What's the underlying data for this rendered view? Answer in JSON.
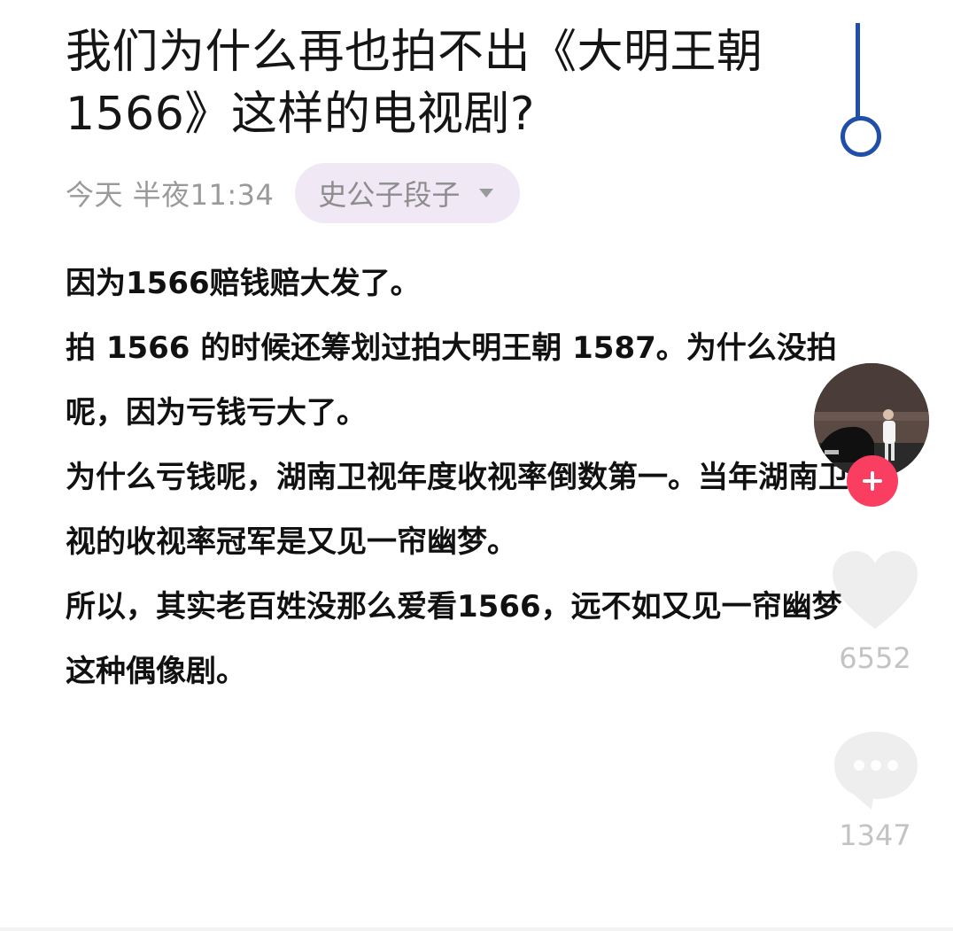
{
  "post": {
    "title": "我们为什么再也拍不出《大明王朝1566》这样的电视剧?",
    "timestamp": "今天 半夜11:34",
    "author": "史公子段子",
    "paragraphs": [
      "因为1566赔钱赔大发了。",
      "拍 1566 的时候还筹划过拍大明王朝 1587。为什么没拍呢，因为亏钱亏大了。",
      "为什么亏钱呢，湖南卫视年度收视率倒数第一。当年湖南卫视的收视率冠军是又见一帘幽梦。",
      "所以，其实老百姓没那么爱看1566，远不如又见一帘幽梦这种偶像剧。"
    ]
  },
  "sidebar": {
    "avatar_icon": "avatar",
    "follow_icon": "plus-icon",
    "like_icon": "heart-icon",
    "like_count": "6552",
    "comment_icon": "comment-icon",
    "comment_count": "1347"
  },
  "colors": {
    "cursor": "#1f4fa8",
    "author_pill": "#f0e8f5",
    "follow_button": "#fa3e61"
  }
}
